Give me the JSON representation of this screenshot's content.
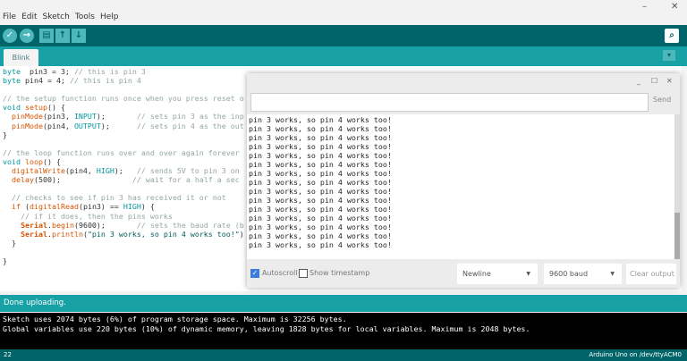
{
  "menu": [
    "File",
    "Edit",
    "Sketch",
    "Tools",
    "Help"
  ],
  "window_controls": {
    "minimize": "–",
    "close": "✕"
  },
  "toolbar": {
    "verify": "✓",
    "upload": "→",
    "new": "▤",
    "open": "↑",
    "save": "↓",
    "serial_monitor": "⌕"
  },
  "tab": {
    "label": "Blink",
    "menu": "▾"
  },
  "code": [
    [
      [
        "kw",
        "byte"
      ],
      [
        "",
        "  pin3 = 3; "
      ],
      [
        "cm",
        "// this is pin 3"
      ]
    ],
    [
      [
        "kw",
        "byte"
      ],
      [
        "",
        " pin4 = 4; "
      ],
      [
        "cm",
        "// this is pin 4"
      ]
    ],
    [],
    [
      [
        "cm",
        "// the setup function runs once when you press reset o"
      ]
    ],
    [
      [
        "kw",
        "void"
      ],
      [
        "fn",
        " setup"
      ],
      [
        "",
        "() {"
      ]
    ],
    [
      [
        "",
        "  "
      ],
      [
        "fn",
        "pinMode"
      ],
      [
        "",
        "(pin3, "
      ],
      [
        "kw",
        "INPUT"
      ],
      [
        "",
        ");       "
      ],
      [
        "cm",
        "// sets pin 3 as the inp"
      ]
    ],
    [
      [
        "",
        "  "
      ],
      [
        "fn",
        "pinMode"
      ],
      [
        "",
        "(pin4, "
      ],
      [
        "kw",
        "OUTPUT"
      ],
      [
        "",
        ");      "
      ],
      [
        "cm",
        "// sets pin 4 as the out"
      ]
    ],
    [
      [
        "",
        "}"
      ]
    ],
    [],
    [
      [
        "cm",
        "// the loop function runs over and over again forever"
      ]
    ],
    [
      [
        "kw",
        "void"
      ],
      [
        "fn",
        " loop"
      ],
      [
        "",
        "() {"
      ]
    ],
    [
      [
        "",
        "  "
      ],
      [
        "fn",
        "digitalWrite"
      ],
      [
        "",
        "(pin4, "
      ],
      [
        "kw",
        "HIGH"
      ],
      [
        "",
        ");   "
      ],
      [
        "cm",
        "// sends 5V to pin 3 on"
      ]
    ],
    [
      [
        "",
        "  "
      ],
      [
        "fn",
        "delay"
      ],
      [
        "",
        "(500);                "
      ],
      [
        "cm",
        "// wait for a half a sec"
      ]
    ],
    [],
    [
      [
        "",
        "  "
      ],
      [
        "cm",
        "// checks to see if pin 3 has received it or not"
      ]
    ],
    [
      [
        "",
        "  "
      ],
      [
        "fn",
        "if"
      ],
      [
        "",
        " ("
      ],
      [
        "fn",
        "digitalRead"
      ],
      [
        "",
        "(pin3) == "
      ],
      [
        "kw",
        "HIGH"
      ],
      [
        "",
        ") {"
      ]
    ],
    [
      [
        "",
        "    "
      ],
      [
        "cm",
        "// if it does, then the pins works"
      ]
    ],
    [
      [
        "",
        "    "
      ],
      [
        "ser",
        "Serial"
      ],
      [
        "",
        "."
      ],
      [
        "fn",
        "begin"
      ],
      [
        "",
        "(9600);       "
      ],
      [
        "cm",
        "// sets the baud rate (b"
      ]
    ],
    [
      [
        "",
        "    "
      ],
      [
        "ser",
        "Serial"
      ],
      [
        "",
        "."
      ],
      [
        "fn",
        "println"
      ],
      [
        "",
        "("
      ],
      [
        "st",
        "\"pin 3 works, so pin 4 works too!\""
      ],
      [
        "",
        ")"
      ]
    ],
    [
      [
        "",
        "  }"
      ]
    ],
    [],
    [
      [
        "",
        "}"
      ]
    ]
  ],
  "serial_monitor": {
    "window_controls": [
      "_",
      "☐",
      "✕"
    ],
    "input_value": "",
    "send_label": "Send",
    "output_line": "pin 3 works, so pin 4 works too!",
    "output_count": 15,
    "autoscroll_label": "Autoscroll",
    "autoscroll_checked": true,
    "timestamp_label": "Show timestamp",
    "timestamp_checked": false,
    "line_ending": "Newline",
    "baud": "9600 baud",
    "clear_label": "Clear output"
  },
  "status": "Done uploading.",
  "console": [
    "Sketch uses 2074 bytes (6%) of program storage space. Maximum is 32256 bytes.",
    "Global variables use 220 bytes (10%) of dynamic memory, leaving 1828 bytes for local variables. Maximum is 2048 bytes."
  ],
  "footer": {
    "line": "22",
    "board": "Arduino Uno on /dev/ttyACM0"
  }
}
